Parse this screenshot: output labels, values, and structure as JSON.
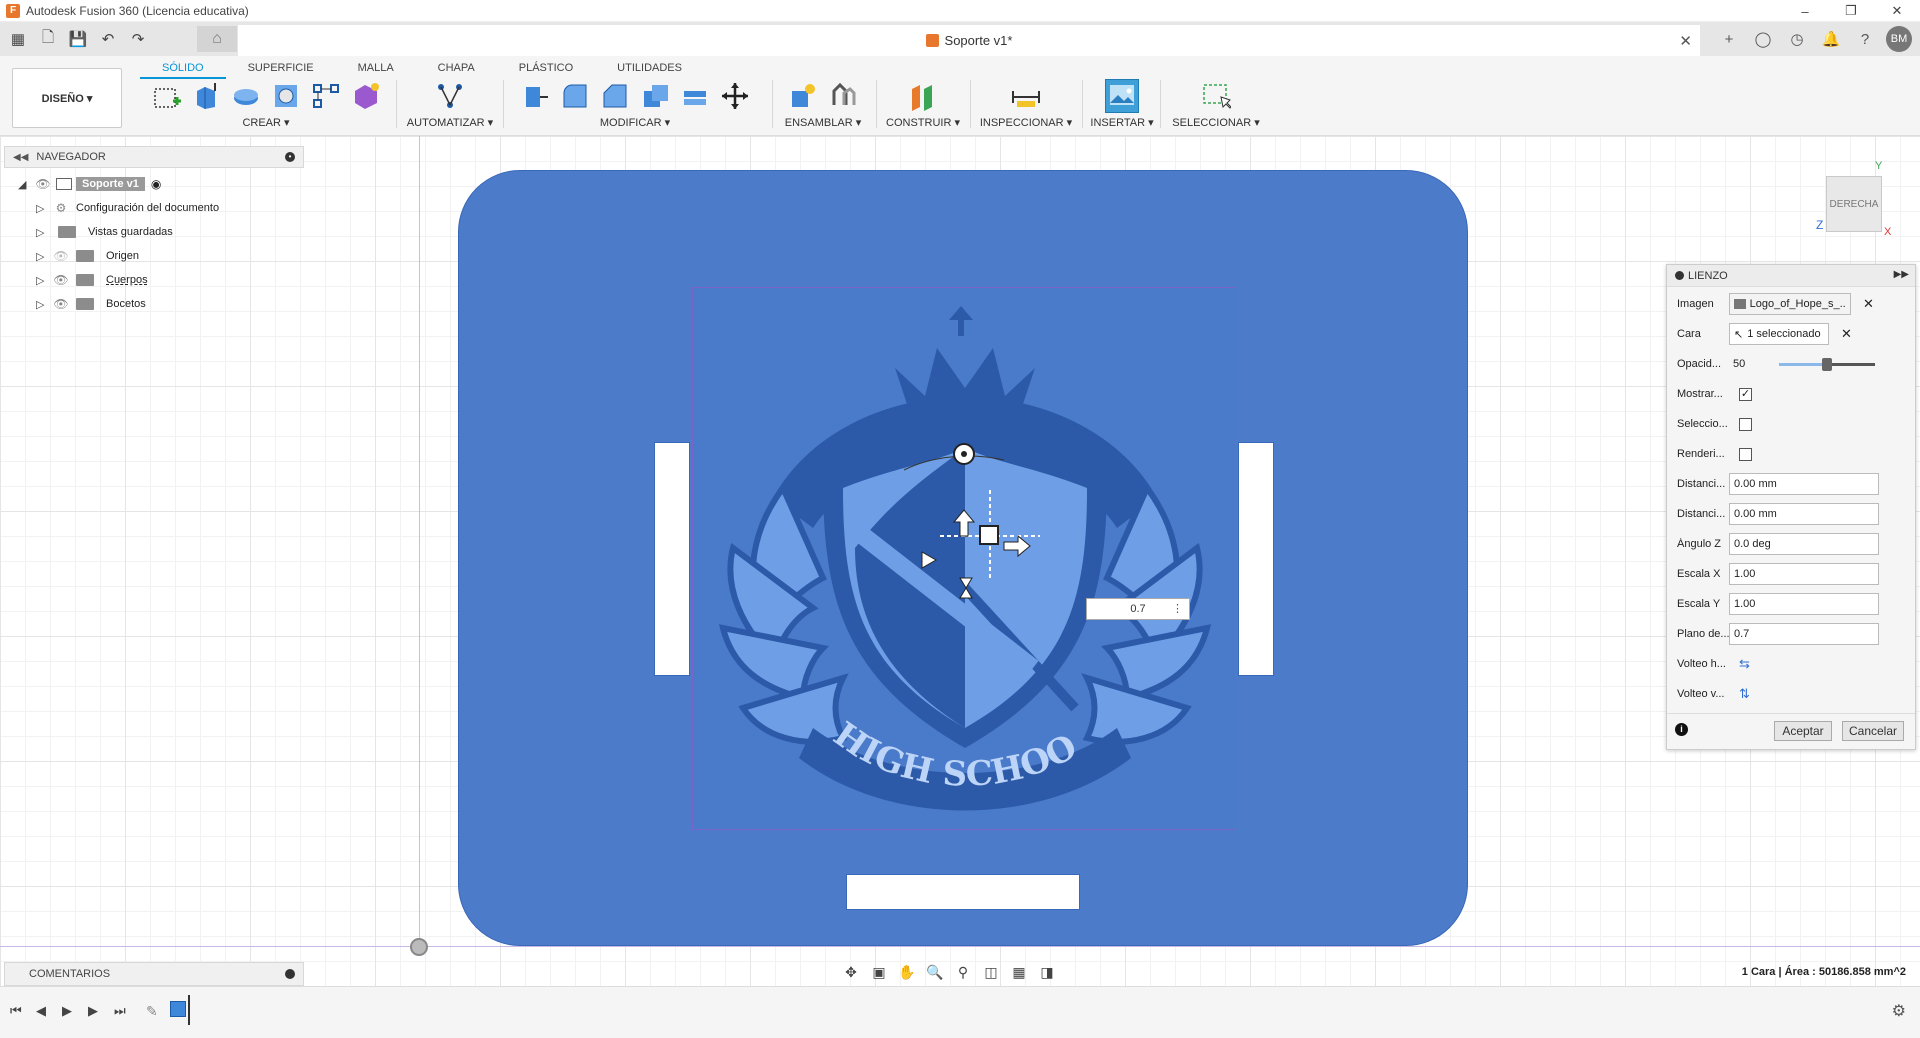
{
  "window": {
    "title": "Autodesk Fusion 360 (Licencia educativa)"
  },
  "document": {
    "tab_title": "Soporte v1*"
  },
  "user": {
    "initials": "BM"
  },
  "workspace": {
    "label": "DISEÑO ▾"
  },
  "ribbon": {
    "tabs": [
      "SÓLIDO",
      "SUPERFICIE",
      "MALLA",
      "CHAPA",
      "PLÁSTICO",
      "UTILIDADES"
    ],
    "active_tab": "SÓLIDO",
    "groups": {
      "crear": "CREAR ▾",
      "automatizar": "AUTOMATIZAR ▾",
      "modificar": "MODIFICAR ▾",
      "ensamblar": "ENSAMBLAR ▾",
      "construir": "CONSTRUIR ▾",
      "inspeccionar": "INSPECCIONAR ▾",
      "insertar": "INSERTAR ▾",
      "seleccionar": "SELECCIONAR ▾"
    }
  },
  "navigator": {
    "title": "NAVEGADOR",
    "root": "Soporte v1",
    "items": [
      {
        "label": "Configuración del documento",
        "icon": "gear-icon"
      },
      {
        "label": "Vistas guardadas",
        "icon": "folder-icon"
      },
      {
        "label": "Origen",
        "icon": "folder-icon"
      },
      {
        "label": "Cuerpos",
        "icon": "folder-icon"
      },
      {
        "label": "Bocetos",
        "icon": "folder-icon"
      }
    ]
  },
  "comments": {
    "label": "COMENTARIOS"
  },
  "viewcube": {
    "label": "DERECHA",
    "axis_y": "Y",
    "axis_z": "Z",
    "axis_x": "X"
  },
  "emblem": {
    "text": "HIGH SCHOOL"
  },
  "value_box": {
    "value": "0.7"
  },
  "lienzo": {
    "title": "LIENZO",
    "rows": {
      "imagen": {
        "label": "Imagen",
        "value": "Logo_of_Hope_s_..."
      },
      "cara": {
        "label": "Cara",
        "value": "1 seleccionado"
      },
      "opacidad": {
        "label": "Opacid...",
        "value": "50",
        "slider_fraction": 0.5
      },
      "mostrar": {
        "label": "Mostrar...",
        "checked": true
      },
      "seleccionable": {
        "label": "Seleccio...",
        "checked": false
      },
      "renderizar": {
        "label": "Renderi...",
        "checked": false
      },
      "distancia1": {
        "label": "Distanci...",
        "value": "0.00 mm"
      },
      "distancia2": {
        "label": "Distanci...",
        "value": "0.00 mm"
      },
      "angulo": {
        "label": "Ángulo Z",
        "value": "0.0 deg"
      },
      "escala_x": {
        "label": "Escala X",
        "value": "1.00"
      },
      "escala_y": {
        "label": "Escala Y",
        "value": "1.00"
      },
      "plano": {
        "label": "Plano de...",
        "value": "0.7"
      },
      "volteo_h": {
        "label": "Volteo h..."
      },
      "volteo_v": {
        "label": "Volteo v..."
      }
    },
    "accept": "Aceptar",
    "cancel": "Cancelar"
  },
  "status": {
    "text": "1 Cara | Área : 50186.858 mm^2"
  },
  "colors": {
    "accent": "#0696d7",
    "plate": "#4c7bc9",
    "emblem_dark": "#2c5aa8",
    "emblem_light": "#6e9fe6"
  }
}
